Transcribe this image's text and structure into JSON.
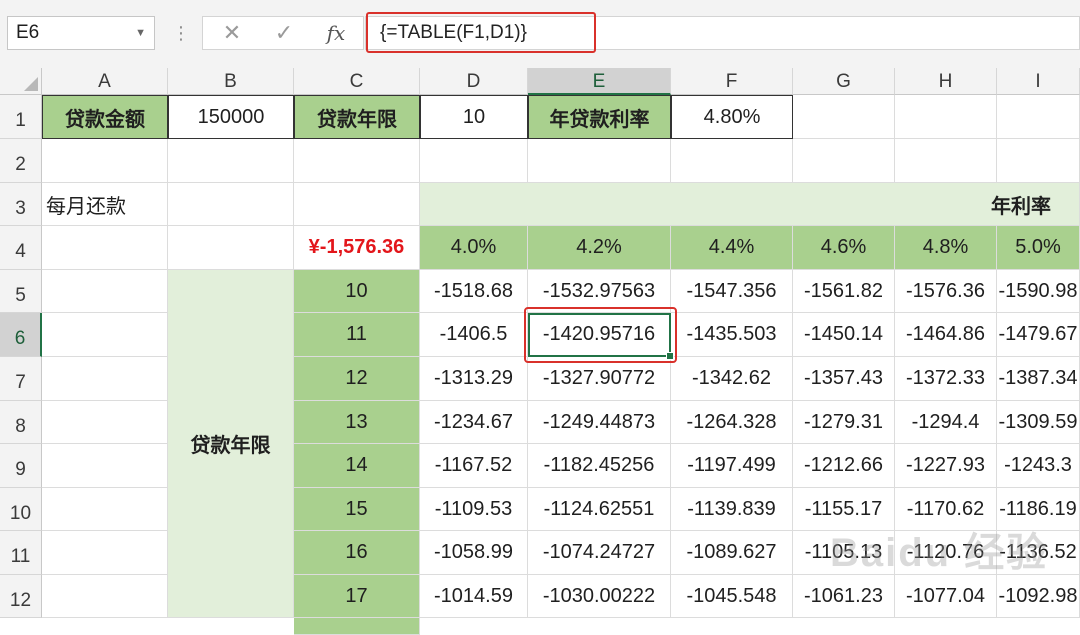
{
  "namebox": {
    "value": "E6"
  },
  "formula_bar": {
    "cancel_icon": "close-icon",
    "enter_icon": "check-icon",
    "fx_label": "fx",
    "formula": "{=TABLE(F1,D1)}"
  },
  "columns": [
    "A",
    "B",
    "C",
    "D",
    "E",
    "F",
    "G",
    "H",
    "I"
  ],
  "rows": [
    "1",
    "2",
    "3",
    "4",
    "5",
    "6",
    "7",
    "8",
    "9",
    "10",
    "11",
    "12"
  ],
  "selected_cell": "E6",
  "row1": {
    "a": "贷款金额",
    "b": "150000",
    "c": "贷款年限",
    "d": "10",
    "e": "年贷款利率",
    "f": "4.80%"
  },
  "row3": {
    "a": "每月还款",
    "header": "年利率"
  },
  "row4": {
    "c": "¥-1,576.36",
    "rates": [
      "4.0%",
      "4.2%",
      "4.4%",
      "4.6%",
      "4.8%",
      "5.0%"
    ]
  },
  "side_label": "贷款年限",
  "table": [
    {
      "year": "10",
      "vals": [
        "-1518.68",
        "-1532.97563",
        "-1547.356",
        "-1561.82",
        "-1576.36",
        "-1590.98"
      ]
    },
    {
      "year": "11",
      "vals": [
        "-1406.5",
        "-1420.95716",
        "-1435.503",
        "-1450.14",
        "-1464.86",
        "-1479.67"
      ]
    },
    {
      "year": "12",
      "vals": [
        "-1313.29",
        "-1327.90772",
        "-1342.62",
        "-1357.43",
        "-1372.33",
        "-1387.34"
      ]
    },
    {
      "year": "13",
      "vals": [
        "-1234.67",
        "-1249.44873",
        "-1264.328",
        "-1279.31",
        "-1294.4",
        "-1309.59"
      ]
    },
    {
      "year": "14",
      "vals": [
        "-1167.52",
        "-1182.45256",
        "-1197.499",
        "-1212.66",
        "-1227.93",
        "-1243.3"
      ]
    },
    {
      "year": "15",
      "vals": [
        "-1109.53",
        "-1124.62551",
        "-1139.839",
        "-1155.17",
        "-1170.62",
        "-1186.19"
      ]
    },
    {
      "year": "16",
      "vals": [
        "-1058.99",
        "-1074.24727",
        "-1089.627",
        "-1105.13",
        "-1120.76",
        "-1136.52"
      ]
    },
    {
      "year": "17",
      "vals": [
        "-1014.59",
        "-1030.00222",
        "-1045.548",
        "-1061.23",
        "-1077.04",
        "-1092.98"
      ]
    }
  ],
  "watermark": "Baidu 经验",
  "colors": {
    "accent": "#217346",
    "highlight_red": "#d9312b",
    "green_dark": "#a9d08e",
    "green_light": "#e2efda"
  }
}
